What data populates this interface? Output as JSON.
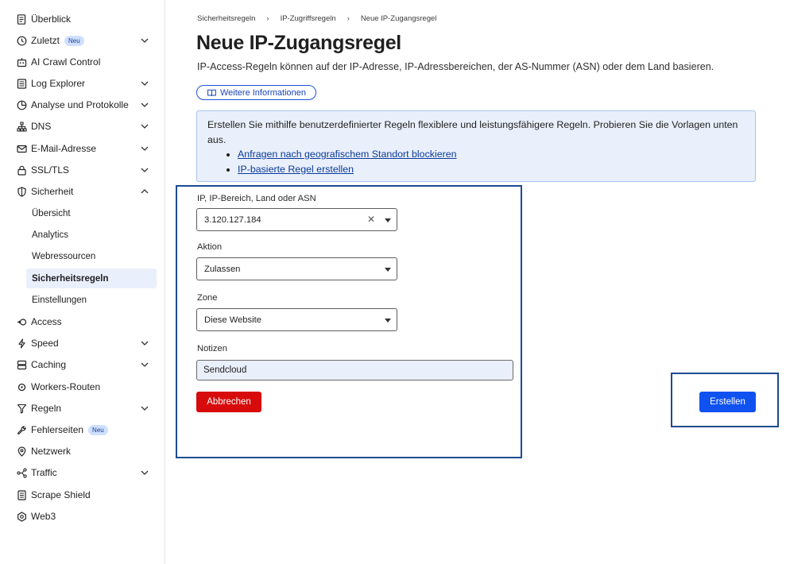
{
  "sidebar": {
    "items": [
      {
        "label": "Überblick",
        "icon": "document-icon"
      },
      {
        "label": "Zuletzt",
        "icon": "clock-icon",
        "badge": "Neu",
        "chevron": "down"
      },
      {
        "label": "AI Crawl Control",
        "icon": "robot-icon"
      },
      {
        "label": "Log Explorer",
        "icon": "log-icon",
        "chevron": "down"
      },
      {
        "label": "Analyse und Protokolle",
        "icon": "chart-icon",
        "chevron": "down"
      },
      {
        "label": "DNS",
        "icon": "network-icon",
        "chevron": "down"
      },
      {
        "label": "E-Mail-Adresse",
        "icon": "mail-icon",
        "chevron": "down"
      },
      {
        "label": "SSL/TLS",
        "icon": "lock-icon",
        "chevron": "down"
      },
      {
        "label": "Sicherheit",
        "icon": "shield-icon",
        "chevron": "up"
      },
      {
        "label": "Access",
        "icon": "access-icon"
      },
      {
        "label": "Speed",
        "icon": "bolt-icon",
        "chevron": "down"
      },
      {
        "label": "Caching",
        "icon": "database-icon",
        "chevron": "down"
      },
      {
        "label": "Workers-Routen",
        "icon": "workers-icon"
      },
      {
        "label": "Regeln",
        "icon": "rules-icon",
        "chevron": "down"
      },
      {
        "label": "Fehlerseiten",
        "icon": "wrench-icon",
        "badge": "Neu"
      },
      {
        "label": "Netzwerk",
        "icon": "location-icon"
      },
      {
        "label": "Traffic",
        "icon": "traffic-icon",
        "chevron": "down"
      },
      {
        "label": "Scrape Shield",
        "icon": "scrape-icon"
      },
      {
        "label": "Web3",
        "icon": "web3-icon"
      }
    ],
    "security_sub": [
      "Übersicht",
      "Analytics",
      "Webressourcen",
      "Sicherheitsregeln",
      "Einstellungen"
    ],
    "active_sub": "Sicherheitsregeln"
  },
  "breadcrumb": [
    "Sicherheitsregeln",
    "IP-Zugriffsregeln",
    "Neue IP-Zugangsregel"
  ],
  "page": {
    "title": "Neue IP-Zugangsregel",
    "subtitle": "IP-Access-Regeln können auf der IP-Adresse, IP-Adressbereichen, der AS-Nummer (ASN) oder dem Land basieren.",
    "info_button": "Weitere Informationen"
  },
  "callout": {
    "text": "Erstellen Sie mithilfe benutzerdefinierter Regeln flexiblere und leistungsfähigere Regeln. Probieren Sie die Vorlagen unten aus.",
    "links": [
      "Anfragen nach geografischem Standort blockieren",
      "IP-basierte Regel erstellen"
    ]
  },
  "form": {
    "ip_label": "IP, IP-Bereich, Land oder ASN",
    "ip_value": "3.120.127.184",
    "action_label": "Aktion",
    "action_value": "Zulassen",
    "zone_label": "Zone",
    "zone_value": "Diese Website",
    "notes_label": "Notizen",
    "notes_value": "Sendcloud",
    "cancel_button": "Abbrechen",
    "create_button": "Erstellen"
  },
  "colors": {
    "accent": "#0f52f0",
    "danger": "#d70b0b",
    "highlight_box": "#1c4b8e",
    "callout_bg": "#e9f0fb"
  }
}
